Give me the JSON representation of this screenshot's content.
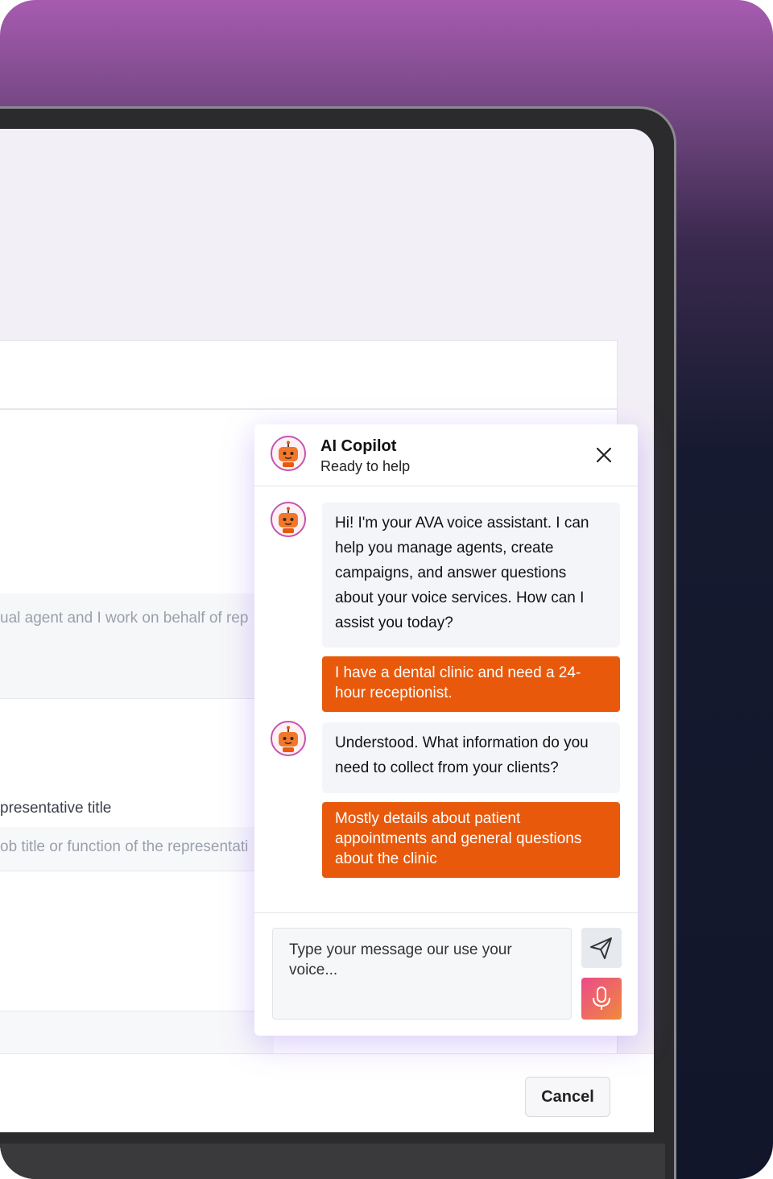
{
  "background_form": {
    "field1_placeholder": "ual agent and I work on behalf of rep",
    "field2_label": "presentative title",
    "field2_placeholder": "ob title or function of the representati",
    "cancel_label": "Cancel"
  },
  "chat": {
    "title": "AI Copilot",
    "subtitle": "Ready to help",
    "close_icon": "close-icon",
    "messages": [
      {
        "role": "assistant",
        "text": "Hi! I'm your AVA voice assistant. I can help you manage agents, create campaigns, and answer questions about your voice services. How can I assist you today?"
      },
      {
        "role": "user",
        "text": "I have a dental clinic and need a 24-hour receptionist."
      },
      {
        "role": "assistant",
        "text": "Understood. What information do you need to collect from your clients?"
      },
      {
        "role": "user",
        "text": "Mostly details about patient appointments and general questions about the clinic"
      }
    ],
    "input_placeholder": "Type your message our use your voice...",
    "send_icon": "send-icon",
    "mic_icon": "microphone-icon"
  },
  "colors": {
    "accent": "#e8590c",
    "avatar_ring": "#c653b0",
    "bubble_bot": "#f3f5f9"
  }
}
